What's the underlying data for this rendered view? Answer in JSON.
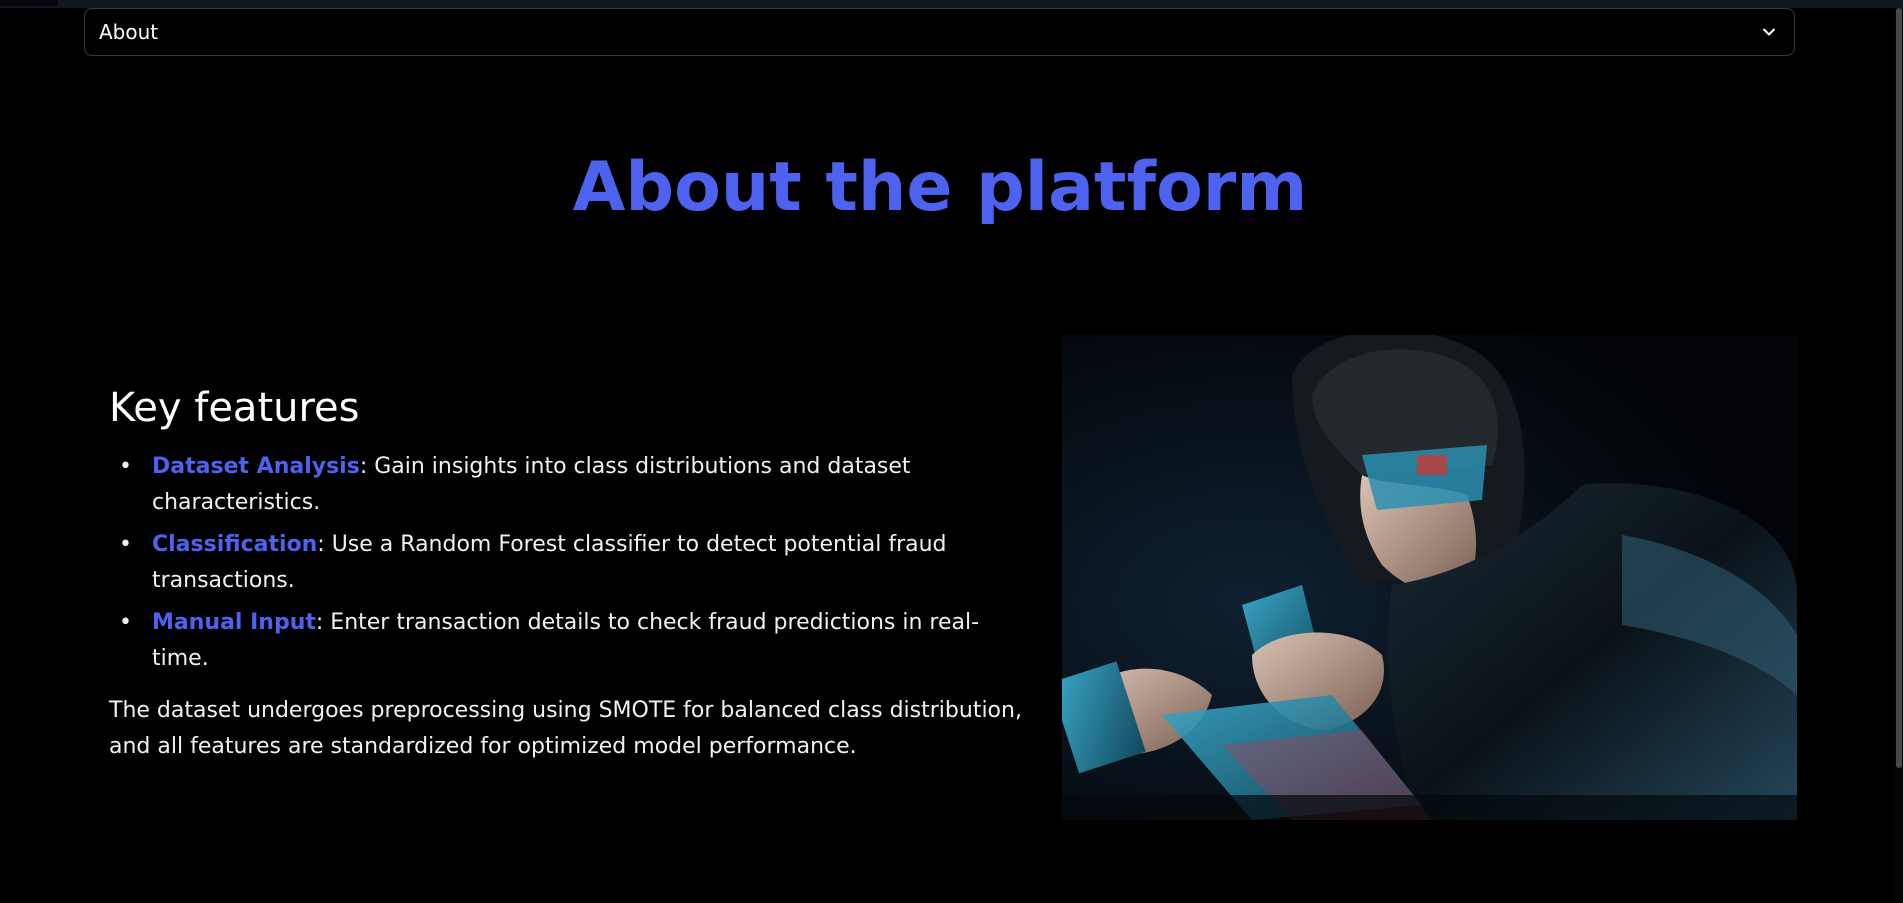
{
  "page": {
    "accent_color": "#4e62f0",
    "background_color": "#000000"
  },
  "nav_select": {
    "value": "About",
    "icon": "chevron-down-icon"
  },
  "hero": {
    "title": "About the platform"
  },
  "key_features": {
    "heading": "Key features",
    "items": [
      {
        "term": "Dataset Analysis",
        "description": ": Gain insights into class distributions and dataset characteristics."
      },
      {
        "term": "Classification",
        "description": ": Use a Random Forest classifier to detect potential fraud transactions."
      },
      {
        "term": "Manual Input",
        "description": ": Enter transaction details to check fraud predictions in real-time."
      }
    ],
    "summary": "The dataset undergoes preprocessing using SMOTE for balanced class distribution, and all features are standardized for optimized model performance."
  },
  "illustration": {
    "subject": "hooded-fraudster-with-credit-cards-image"
  }
}
